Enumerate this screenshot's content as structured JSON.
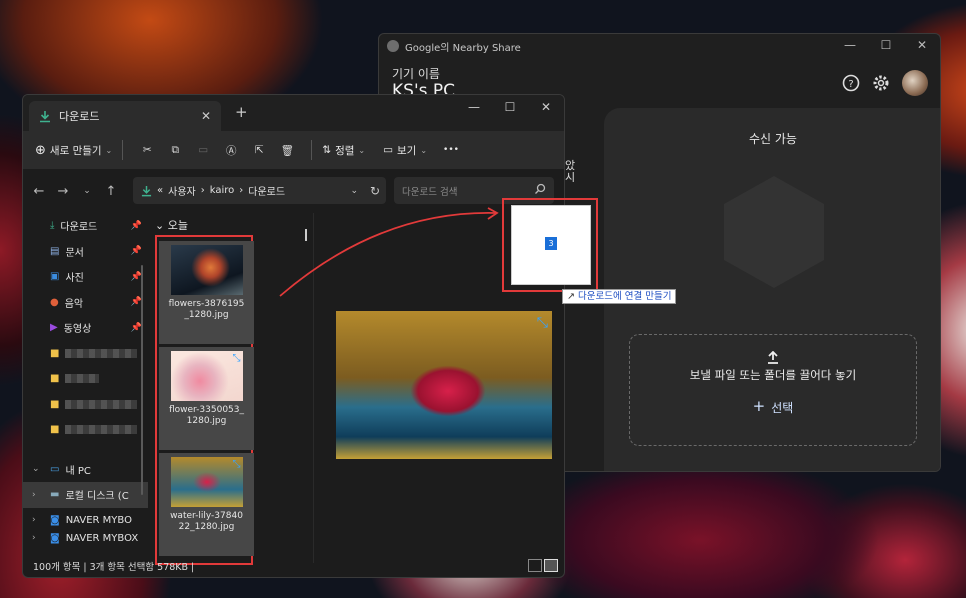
{
  "nearby": {
    "title": "Google의 Nearby Share",
    "window_controls": [
      "—",
      "☐",
      "✕"
    ],
    "device_label": "기기 이름",
    "device_name": "KS's PC",
    "left_fragment": [
      "았",
      "시"
    ],
    "receive_status": "수신 가능",
    "drop_text": "보낼 파일 또는 폴더를 끌어다 놓기",
    "select_plus": "+",
    "select_label": "선택"
  },
  "explorer": {
    "tab_label": "다운로드",
    "tab_close": "✕",
    "new_tab": "+",
    "window_controls": [
      "—",
      "☐",
      "✕"
    ],
    "new_button": "새로 만들기",
    "sort_button": "정렬",
    "view_button": "보기",
    "more": "•••",
    "path": {
      "overflow": "«",
      "items": [
        "사용자",
        "kairo",
        "다운로드"
      ],
      "separator": "›"
    },
    "search_placeholder": "다운로드 검색",
    "nav_items": [
      {
        "label": "다운로드",
        "icon": "download-icon"
      },
      {
        "label": "문서",
        "icon": "document-icon"
      },
      {
        "label": "사진",
        "icon": "picture-icon"
      },
      {
        "label": "음악",
        "icon": "music-icon"
      },
      {
        "label": "동영상",
        "icon": "video-icon"
      }
    ],
    "nav_pc": "내 PC",
    "nav_drive": "로컬 디스크 (C",
    "nav_naver1": "NAVER MYBO",
    "nav_naver2": "NAVER MYBOX",
    "group_label": "오늘",
    "files": [
      {
        "name": "flowers-3876195_1280.jpg",
        "line1": "flowers-3876195",
        "line2": "_1280.jpg"
      },
      {
        "name": "flower-3350053_1280.jpg",
        "line1": "flower-3350053_",
        "line2": "1280.jpg"
      },
      {
        "name": "water-lily-3784022_1280.jpg",
        "line1": "water-lily-37840",
        "line2": "22_1280.jpg"
      }
    ],
    "status": "100개 항목  |  3개 항목 선택함 578KB  |"
  },
  "drag": {
    "count": "3",
    "tooltip_arrow": "↗",
    "tooltip": "다운로드에 연결 만들기"
  },
  "colors": {
    "accent": "#36a3ff",
    "highlight": "#e23a3a",
    "badge": "#1a6fd8"
  }
}
